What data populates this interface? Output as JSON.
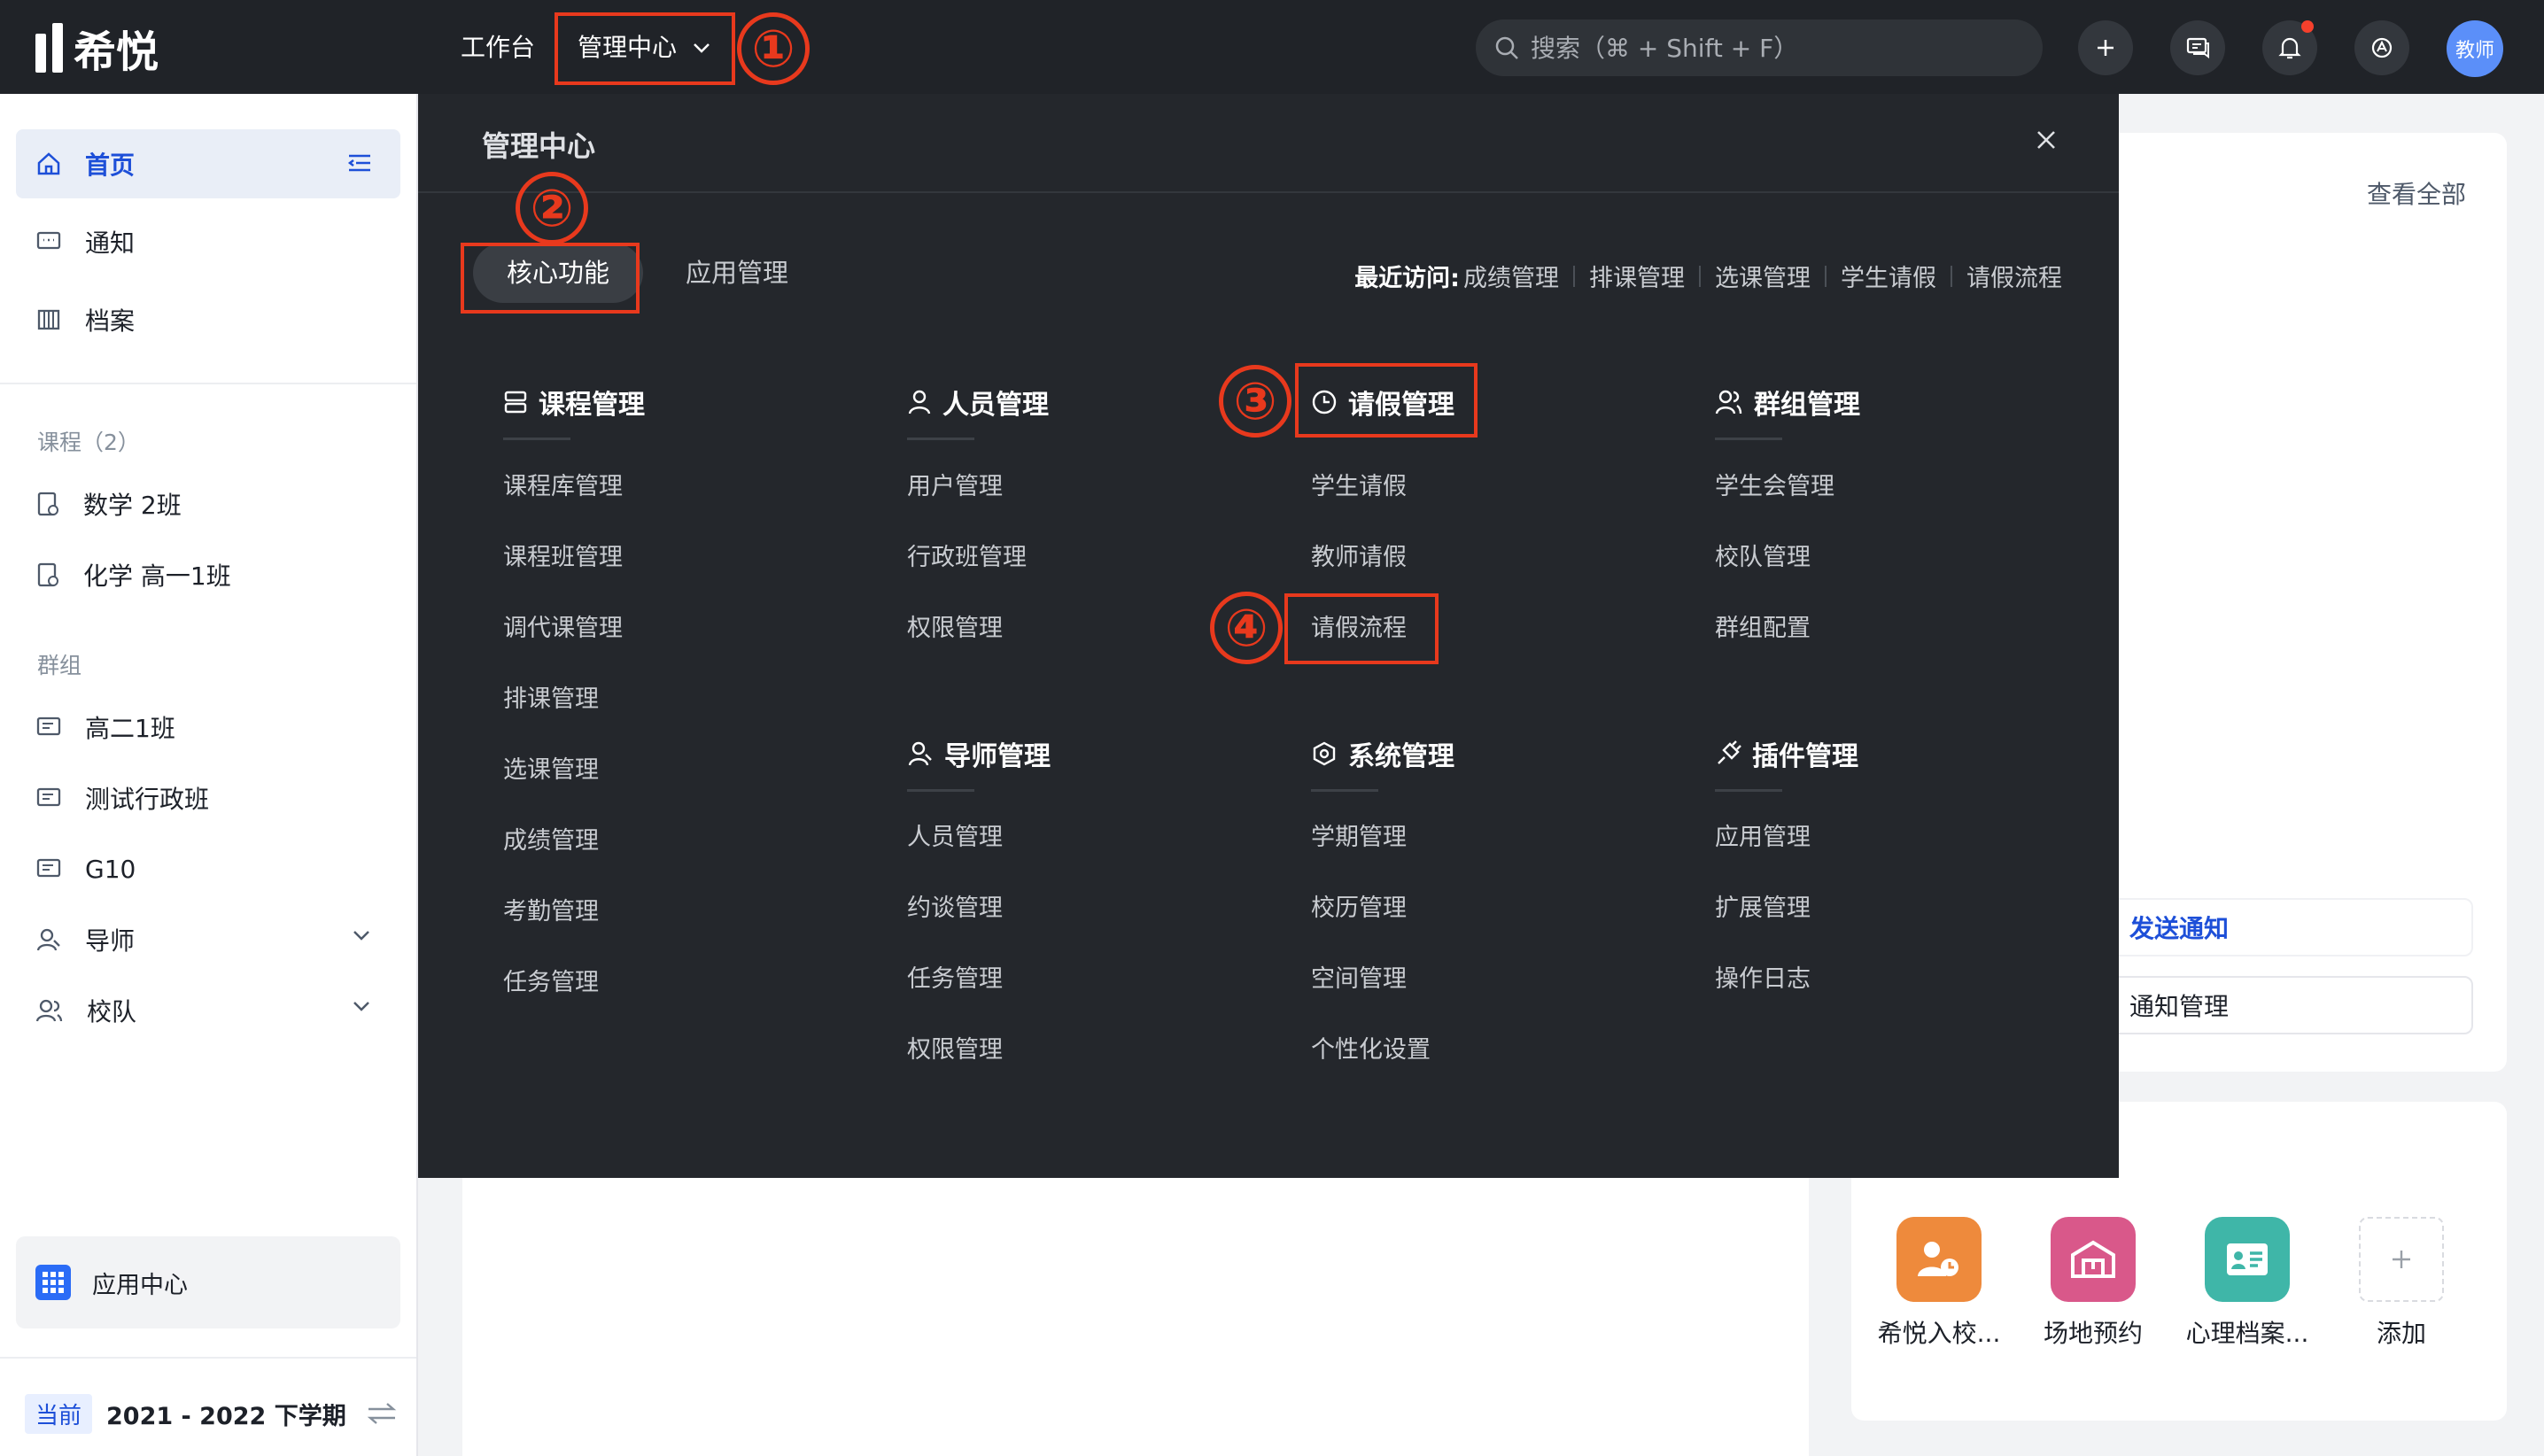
{
  "topbar": {
    "logo_text": "希悦",
    "nav_workbench": "工作台",
    "nav_admin_center": "管理中心",
    "search_placeholder": "搜索（⌘ + Shift + F）",
    "avatar_text": "教师"
  },
  "annotations": [
    "①",
    "②",
    "③",
    "④"
  ],
  "sidebar": {
    "home": "首页",
    "notice": "通知",
    "archive": "档案",
    "courses_section": "课程（2）",
    "courses": [
      "数学 2班",
      "化学 高一1班"
    ],
    "groups_section": "群组",
    "groups": [
      "高二1班",
      "测试行政班",
      "G10"
    ],
    "mentor": "导师",
    "team": "校队",
    "app_center": "应用中心",
    "term_badge": "当前",
    "term_text": "2021 - 2022 下学期"
  },
  "overlay": {
    "title": "管理中心",
    "tabs": [
      "核心功能",
      "应用管理"
    ],
    "recent_label": "最近访问:",
    "recent_links": [
      "成绩管理",
      "排课管理",
      "选课管理",
      "学生请假",
      "请假流程"
    ],
    "columns": [
      {
        "title": "课程管理",
        "icon": "course-icon",
        "items": [
          "课程库管理",
          "课程班管理",
          "调代课管理",
          "排课管理",
          "选课管理",
          "成绩管理",
          "考勤管理",
          "任务管理"
        ]
      },
      {
        "title": "人员管理",
        "icon": "person-icon",
        "items": [
          "用户管理",
          "行政班管理",
          "权限管理"
        ]
      },
      {
        "title": "请假管理",
        "icon": "clock-icon",
        "items": [
          "学生请假",
          "教师请假",
          "请假流程"
        ]
      },
      {
        "title": "群组管理",
        "icon": "group-icon",
        "items": [
          "学生会管理",
          "校队管理",
          "群组配置"
        ]
      },
      {
        "title": "导师管理",
        "icon": "mentor-icon",
        "items": [
          "人员管理",
          "约谈管理",
          "任务管理",
          "权限管理"
        ]
      },
      {
        "title": "系统管理",
        "icon": "system-icon",
        "items": [
          "学期管理",
          "校历管理",
          "空间管理",
          "个性化设置"
        ]
      },
      {
        "title": "插件管理",
        "icon": "plugin-icon",
        "items": [
          "应用管理",
          "扩展管理",
          "操作日志"
        ]
      }
    ]
  },
  "right_panel": {
    "view_all": "查看全部",
    "send_notice": "发送通知",
    "notice_manage": "通知管理",
    "apps": [
      {
        "label": "希悦入校...",
        "color": "#ee8a3c"
      },
      {
        "label": "场地预约",
        "color": "#d9588a"
      },
      {
        "label": "心理档案...",
        "color": "#3fb6a8"
      },
      {
        "label": "添加",
        "color": "#ffffff"
      }
    ]
  },
  "colors": {
    "topbar_bg": "#202328",
    "overlay_bg": "#24272c",
    "accent_blue": "#1d4fd8",
    "annotation_red": "#e8391d"
  }
}
